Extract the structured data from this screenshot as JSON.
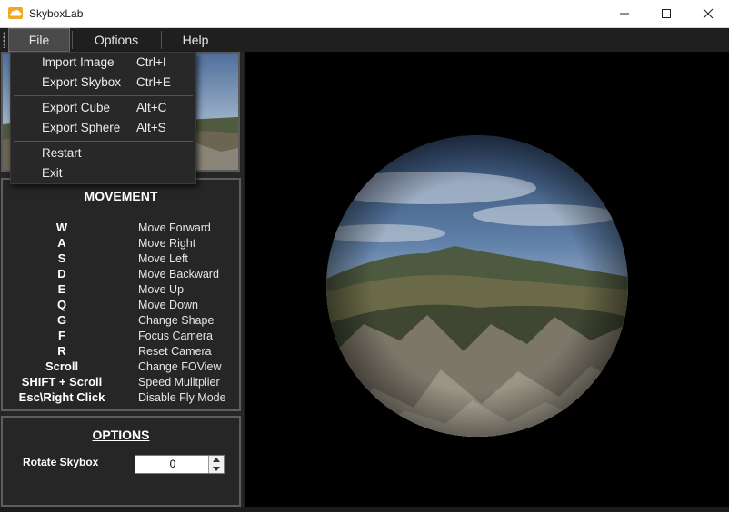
{
  "window": {
    "title": "SkyboxLab",
    "brand_color": "#f5a623"
  },
  "menubar": {
    "items": [
      "File",
      "Options",
      "Help"
    ]
  },
  "file_menu": {
    "groups": [
      [
        {
          "label": "Import Image",
          "shortcut": "Ctrl+I"
        },
        {
          "label": "Export Skybox",
          "shortcut": "Ctrl+E"
        }
      ],
      [
        {
          "label": "Export Cube",
          "shortcut": "Alt+C"
        },
        {
          "label": "Export Sphere",
          "shortcut": "Alt+S"
        }
      ],
      [
        {
          "label": "Restart",
          "shortcut": ""
        },
        {
          "label": "Exit",
          "shortcut": ""
        }
      ]
    ]
  },
  "movement": {
    "title": "MOVEMENT",
    "bindings": [
      {
        "key": "W",
        "action": "Move Forward"
      },
      {
        "key": "A",
        "action": "Move Right"
      },
      {
        "key": "S",
        "action": "Move Left"
      },
      {
        "key": "D",
        "action": "Move Backward"
      },
      {
        "key": "E",
        "action": "Move Up"
      },
      {
        "key": "Q",
        "action": "Move Down"
      },
      {
        "key": "G",
        "action": "Change Shape"
      },
      {
        "key": "F",
        "action": "Focus Camera"
      },
      {
        "key": "R",
        "action": "Reset Camera"
      },
      {
        "key": "Scroll",
        "action": "Change FOView"
      },
      {
        "key": "SHIFT + Scroll",
        "action": "Speed Mulitplier"
      },
      {
        "key": "Esc\\Right Click",
        "action": "Disable Fly Mode"
      }
    ]
  },
  "options": {
    "title": "OPTIONS",
    "rotate_label": "Rotate Skybox",
    "rotate_value": "0"
  }
}
